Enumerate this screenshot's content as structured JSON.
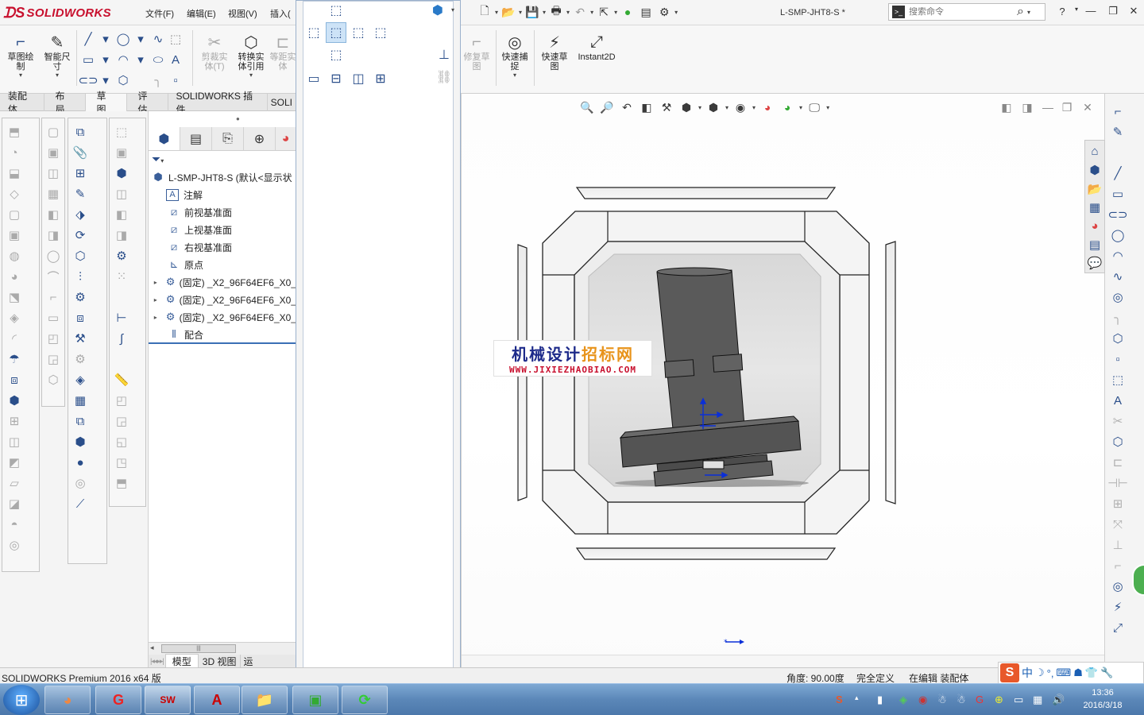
{
  "app": {
    "logo_text": "SOLIDWORKS",
    "menus": [
      "文件(F)",
      "编辑(E)",
      "视图(V)",
      "插入("
    ],
    "document_title": "L-SMP-JHT8-S *",
    "search_placeholder": "搜索命令",
    "help_label": "?"
  },
  "ribbon": {
    "left_buttons": [
      {
        "label": "草图绘\n制",
        "icon": "sketch-icon"
      },
      {
        "label": "智能尺\n寸",
        "icon": "smart-dimension-icon"
      }
    ],
    "mid_buttons": [
      {
        "label": "剪裁实\n体(T)",
        "icon": "trim-icon",
        "disabled": true
      },
      {
        "label": "转换实\n体引用",
        "icon": "convert-entities-icon",
        "disabled": false
      },
      {
        "label": "等距实\n体",
        "icon": "offset-icon",
        "disabled": true
      }
    ],
    "right_buttons": [
      {
        "label": "修复草\n图",
        "icon": "repair-sketch-icon",
        "disabled": true
      },
      {
        "label": "快速捕\n捉",
        "icon": "quick-snap-icon",
        "disabled": false
      },
      {
        "label": "快速草\n图",
        "icon": "rapid-sketch-icon",
        "disabled": false
      },
      {
        "label": "Instant2D",
        "icon": "instant2d-icon",
        "disabled": false
      }
    ]
  },
  "tabs": [
    {
      "label": "装配体",
      "active": false
    },
    {
      "label": "布局",
      "active": false
    },
    {
      "label": "草图",
      "active": true
    },
    {
      "label": "评估",
      "active": false
    },
    {
      "label": "SOLIDWORKS 插件",
      "active": false
    },
    {
      "label": "SOLI",
      "active": false
    }
  ],
  "feature_tree": {
    "root": "L-SMP-JHT8-S  (默认<显示状",
    "items": [
      {
        "label": "注解",
        "icon": "annotation-icon",
        "expandable": false
      },
      {
        "label": "前视基准面",
        "icon": "plane-icon",
        "expandable": false
      },
      {
        "label": "上视基准面",
        "icon": "plane-icon",
        "expandable": false
      },
      {
        "label": "右视基准面",
        "icon": "plane-icon",
        "expandable": false
      },
      {
        "label": "原点",
        "icon": "origin-icon",
        "expandable": false
      },
      {
        "label": "(固定) _X2_96F64EF6_X0_",
        "icon": "part-icon",
        "expandable": true
      },
      {
        "label": "(固定) _X2_96F64EF6_X0_",
        "icon": "part-icon",
        "expandable": true
      },
      {
        "label": "(固定) _X2_96F64EF6_X0_",
        "icon": "part-icon",
        "expandable": true
      },
      {
        "label": "配合",
        "icon": "mates-icon",
        "expandable": false
      }
    ],
    "bottom_tabs": [
      "模型",
      "3D 视图",
      "运"
    ]
  },
  "watermark": {
    "title_part1": "机械设计",
    "title_part2": "招标网",
    "url": "WWW.JIXIEZHAOBIAO.COM"
  },
  "status": {
    "app_version": "SOLIDWORKS Premium 2016 x64 版",
    "angle": "角度: 90.00度",
    "definition": "完全定义",
    "editing": "在编辑 装配体"
  },
  "taskbar": {
    "time": "13:36",
    "date": "2016/3/18",
    "ime": "中"
  },
  "colors": {
    "accent": "#2a4e8a",
    "brand_red": "#c8102e",
    "model_gray": "#555555"
  }
}
